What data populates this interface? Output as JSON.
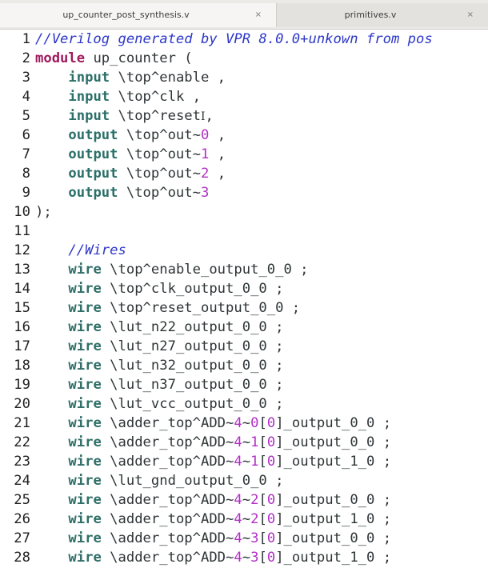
{
  "tabs": [
    {
      "label": "up_counter_post_synthesis.v",
      "close": "×"
    },
    {
      "label": "primitives.v",
      "close": "×"
    }
  ],
  "lines": [
    {
      "n": "1",
      "segs": [
        [
          "comment",
          "//Verilog generated by VPR 8.0.0+unkown from pos"
        ]
      ]
    },
    {
      "n": "2",
      "segs": [
        [
          "kw",
          "module"
        ],
        [
          "t",
          " up_counter ("
        ]
      ]
    },
    {
      "n": "3",
      "segs": [
        [
          "t",
          "    "
        ],
        [
          "port",
          "input"
        ],
        [
          "t",
          " \\top^enable ,"
        ]
      ]
    },
    {
      "n": "4",
      "segs": [
        [
          "t",
          "    "
        ],
        [
          "port",
          "input"
        ],
        [
          "t",
          " \\top^clk ,"
        ]
      ]
    },
    {
      "n": "5",
      "segs": [
        [
          "t",
          "    "
        ],
        [
          "port",
          "input"
        ],
        [
          "t",
          " \\top^reset"
        ],
        [
          "cursor",
          "I"
        ],
        [
          "t",
          ","
        ]
      ]
    },
    {
      "n": "6",
      "segs": [
        [
          "t",
          "    "
        ],
        [
          "port",
          "output"
        ],
        [
          "t",
          " \\top^out~"
        ],
        [
          "num",
          "0"
        ],
        [
          "t",
          " ,"
        ]
      ]
    },
    {
      "n": "7",
      "segs": [
        [
          "t",
          "    "
        ],
        [
          "port",
          "output"
        ],
        [
          "t",
          " \\top^out~"
        ],
        [
          "num",
          "1"
        ],
        [
          "t",
          " ,"
        ]
      ]
    },
    {
      "n": "8",
      "segs": [
        [
          "t",
          "    "
        ],
        [
          "port",
          "output"
        ],
        [
          "t",
          " \\top^out~"
        ],
        [
          "num",
          "2"
        ],
        [
          "t",
          " ,"
        ]
      ]
    },
    {
      "n": "9",
      "segs": [
        [
          "t",
          "    "
        ],
        [
          "port",
          "output"
        ],
        [
          "t",
          " \\top^out~"
        ],
        [
          "num",
          "3"
        ]
      ]
    },
    {
      "n": "10",
      "segs": [
        [
          "t",
          ");"
        ]
      ]
    },
    {
      "n": "11",
      "segs": []
    },
    {
      "n": "12",
      "segs": [
        [
          "t",
          "    "
        ],
        [
          "comment",
          "//Wires"
        ]
      ]
    },
    {
      "n": "13",
      "segs": [
        [
          "t",
          "    "
        ],
        [
          "wire",
          "wire"
        ],
        [
          "t",
          " \\top^enable_output_0_0 ;"
        ]
      ]
    },
    {
      "n": "14",
      "segs": [
        [
          "t",
          "    "
        ],
        [
          "wire",
          "wire"
        ],
        [
          "t",
          " \\top^clk_output_0_0 ;"
        ]
      ]
    },
    {
      "n": "15",
      "segs": [
        [
          "t",
          "    "
        ],
        [
          "wire",
          "wire"
        ],
        [
          "t",
          " \\top^reset_output_0_0 ;"
        ]
      ]
    },
    {
      "n": "16",
      "segs": [
        [
          "t",
          "    "
        ],
        [
          "wire",
          "wire"
        ],
        [
          "t",
          " \\lut_n22_output_0_0 ;"
        ]
      ]
    },
    {
      "n": "17",
      "segs": [
        [
          "t",
          "    "
        ],
        [
          "wire",
          "wire"
        ],
        [
          "t",
          " \\lut_n27_output_0_0 ;"
        ]
      ]
    },
    {
      "n": "18",
      "segs": [
        [
          "t",
          "    "
        ],
        [
          "wire",
          "wire"
        ],
        [
          "t",
          " \\lut_n32_output_0_0 ;"
        ]
      ]
    },
    {
      "n": "19",
      "segs": [
        [
          "t",
          "    "
        ],
        [
          "wire",
          "wire"
        ],
        [
          "t",
          " \\lut_n37_output_0_0 ;"
        ]
      ]
    },
    {
      "n": "20",
      "segs": [
        [
          "t",
          "    "
        ],
        [
          "wire",
          "wire"
        ],
        [
          "t",
          " \\lut_vcc_output_0_0 ;"
        ]
      ]
    },
    {
      "n": "21",
      "segs": [
        [
          "t",
          "    "
        ],
        [
          "wire",
          "wire"
        ],
        [
          "t",
          " \\adder_top^ADD~"
        ],
        [
          "num",
          "4"
        ],
        [
          "t",
          "~"
        ],
        [
          "num",
          "0"
        ],
        [
          "t",
          "["
        ],
        [
          "num",
          "0"
        ],
        [
          "t",
          "]_output_0_0 ;"
        ]
      ]
    },
    {
      "n": "22",
      "segs": [
        [
          "t",
          "    "
        ],
        [
          "wire",
          "wire"
        ],
        [
          "t",
          " \\adder_top^ADD~"
        ],
        [
          "num",
          "4"
        ],
        [
          "t",
          "~"
        ],
        [
          "num",
          "1"
        ],
        [
          "t",
          "["
        ],
        [
          "num",
          "0"
        ],
        [
          "t",
          "]_output_0_0 ;"
        ]
      ]
    },
    {
      "n": "23",
      "segs": [
        [
          "t",
          "    "
        ],
        [
          "wire",
          "wire"
        ],
        [
          "t",
          " \\adder_top^ADD~"
        ],
        [
          "num",
          "4"
        ],
        [
          "t",
          "~"
        ],
        [
          "num",
          "1"
        ],
        [
          "t",
          "["
        ],
        [
          "num",
          "0"
        ],
        [
          "t",
          "]_output_1_0 ;"
        ]
      ]
    },
    {
      "n": "24",
      "segs": [
        [
          "t",
          "    "
        ],
        [
          "wire",
          "wire"
        ],
        [
          "t",
          " \\lut_gnd_output_0_0 ;"
        ]
      ]
    },
    {
      "n": "25",
      "segs": [
        [
          "t",
          "    "
        ],
        [
          "wire",
          "wire"
        ],
        [
          "t",
          " \\adder_top^ADD~"
        ],
        [
          "num",
          "4"
        ],
        [
          "t",
          "~"
        ],
        [
          "num",
          "2"
        ],
        [
          "t",
          "["
        ],
        [
          "num",
          "0"
        ],
        [
          "t",
          "]_output_0_0 ;"
        ]
      ]
    },
    {
      "n": "26",
      "segs": [
        [
          "t",
          "    "
        ],
        [
          "wire",
          "wire"
        ],
        [
          "t",
          " \\adder_top^ADD~"
        ],
        [
          "num",
          "4"
        ],
        [
          "t",
          "~"
        ],
        [
          "num",
          "2"
        ],
        [
          "t",
          "["
        ],
        [
          "num",
          "0"
        ],
        [
          "t",
          "]_output_1_0 ;"
        ]
      ]
    },
    {
      "n": "27",
      "segs": [
        [
          "t",
          "    "
        ],
        [
          "wire",
          "wire"
        ],
        [
          "t",
          " \\adder_top^ADD~"
        ],
        [
          "num",
          "4"
        ],
        [
          "t",
          "~"
        ],
        [
          "num",
          "3"
        ],
        [
          "t",
          "["
        ],
        [
          "num",
          "0"
        ],
        [
          "t",
          "]_output_0_0 ;"
        ]
      ]
    },
    {
      "n": "28",
      "segs": [
        [
          "t",
          "    "
        ],
        [
          "wire",
          "wire"
        ],
        [
          "t",
          " \\adder_top^ADD~"
        ],
        [
          "num",
          "4"
        ],
        [
          "t",
          "~"
        ],
        [
          "num",
          "3"
        ],
        [
          "t",
          "["
        ],
        [
          "num",
          "0"
        ],
        [
          "t",
          "]_output_1_0 ;"
        ]
      ]
    }
  ]
}
